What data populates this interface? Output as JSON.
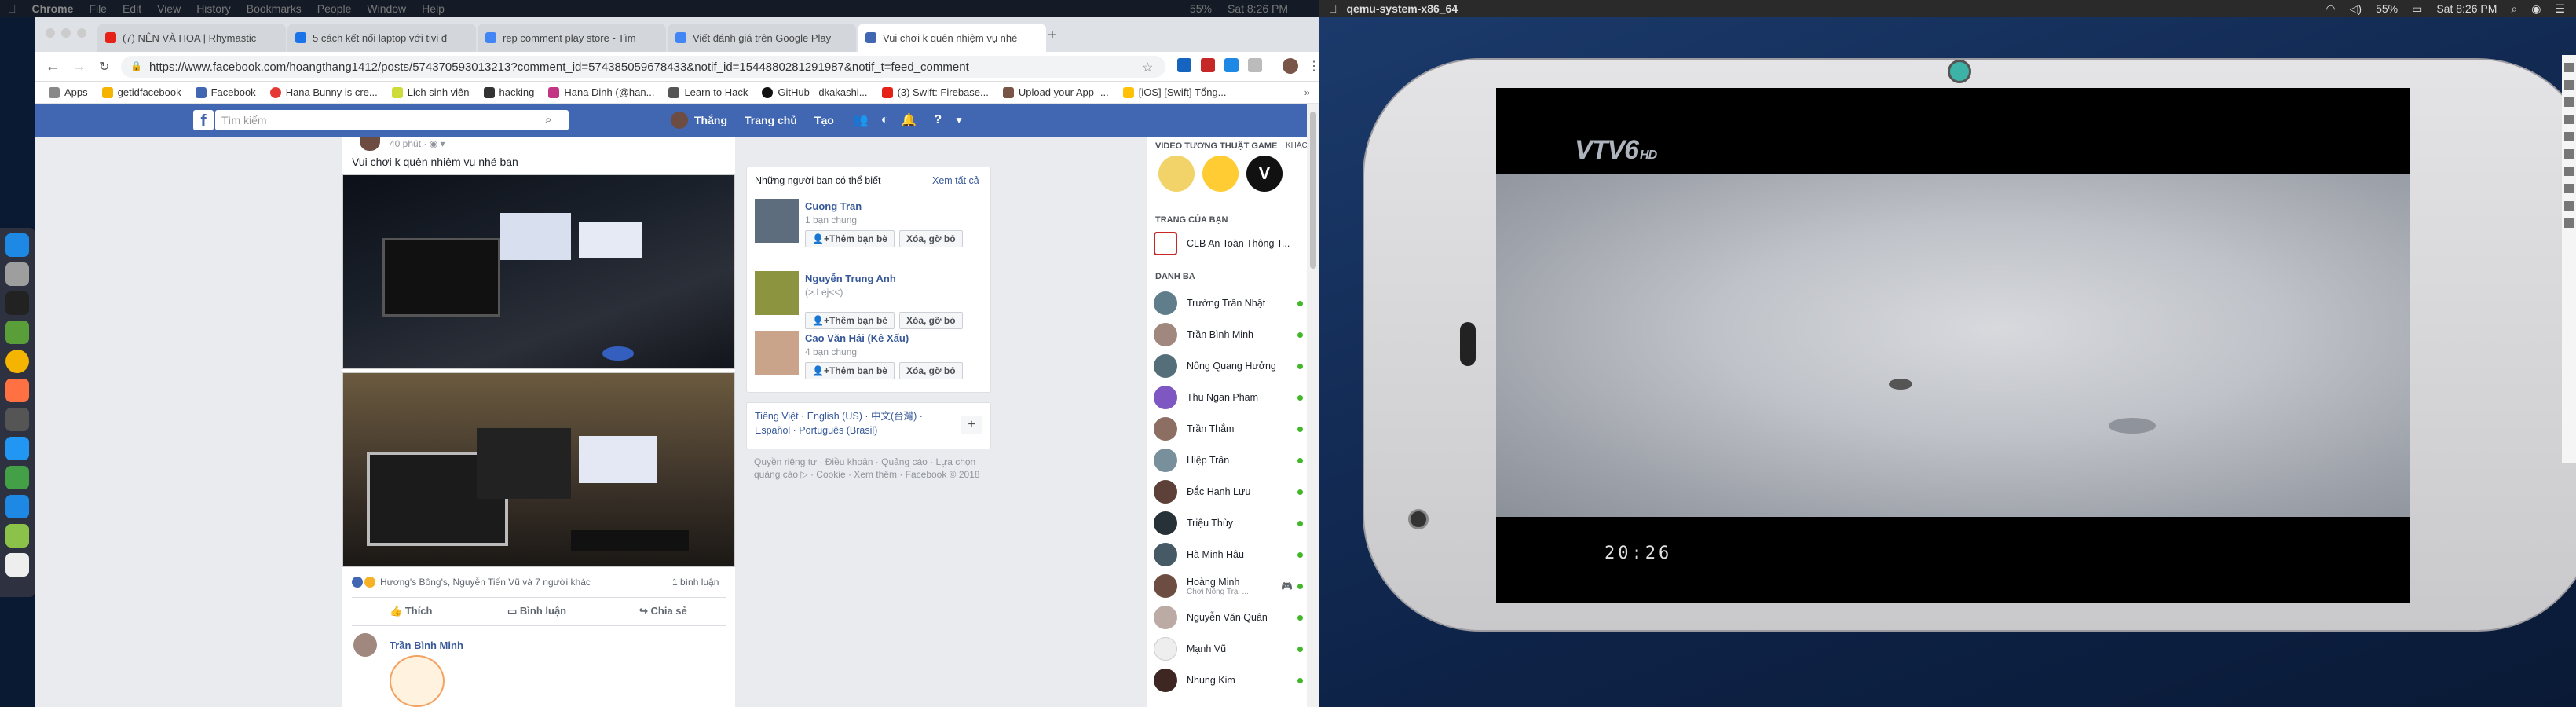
{
  "mac_menu_left": {
    "app": "Chrome",
    "items": [
      "File",
      "Edit",
      "View",
      "History",
      "Bookmarks",
      "People",
      "Window",
      "Help"
    ],
    "battery": "55%",
    "time": "Sat 8:26 PM"
  },
  "mac_menu_right": {
    "app": "qemu-system-x86_64",
    "battery": "55%",
    "time": "Sat 8:26 PM"
  },
  "tabs": [
    {
      "label": "(7) NÊN VÀ HOA | Rhymastic",
      "color": "#e62117"
    },
    {
      "label": "5 cách kết nối laptop với tivi đ",
      "color": "#1a73e8"
    },
    {
      "label": "rep comment play store - Tìm",
      "color": "#4285f4"
    },
    {
      "label": "Viết đánh giá trên Google Play",
      "color": "#4285f4"
    },
    {
      "label": "Vui chơi k quên nhiệm vụ nhé",
      "color": "#4267b2"
    }
  ],
  "url": "https://www.facebook.com/hoangthang1412/posts/574370593013213?comment_id=574385059678433&notif_id=1544880281291987&notif_t=feed_comment",
  "bookmarks": [
    "Apps",
    "getidfacebook",
    "Facebook",
    "Hana Bunny is cre...",
    "Lịch sinh viên",
    "hacking",
    "Hana Dinh (@han...",
    "Learn to Hack",
    "GitHub - dkakashi...",
    "(3) Swift: Firebase...",
    "Upload your App -...",
    "[iOS] [Swift] Tổng..."
  ],
  "fb": {
    "search_placeholder": "Tìm kiếm",
    "nav": {
      "user": "Thắng",
      "home": "Trang chủ",
      "create": "Tạo"
    },
    "post": {
      "time": "40 phút · ",
      "caption": "Vui chơi k quên nhiệm vụ nhé bạn",
      "reactions": "Hương's Bông's, Nguyễn Tiến Vũ và 7 người khác",
      "comments": "1 bình luận",
      "like": "Thích",
      "comment": "Bình luận",
      "share": "Chia sẻ",
      "commenter": "Trần Bình Minh"
    },
    "suggestions": {
      "title": "Những người bạn có thể biết",
      "see_all": "Xem tất cả",
      "add": "Thêm bạn bè",
      "remove": "Xóa, gỡ bỏ",
      "people": [
        {
          "name": "Cuong Tran",
          "sub": "1 bạn chung"
        },
        {
          "name": "Nguyễn Trung Anh",
          "sub": "(>.Lej<<)"
        },
        {
          "name": "Cao Văn Hải (Kê Xấu)",
          "sub": "4 bạn chung"
        }
      ]
    },
    "languages": "Tiếng Việt · English (US) · 中文(台灣) · Español · Português (Brasil)",
    "footer": "Quyền riêng tư · Điều khoản · Quảng cáo · Lựa chọn quảng cáo ▷ · Cookie · Xem thêm · Facebook © 2018",
    "chat": {
      "games_header": "VIDEO TƯƠNG THUẬT GAME",
      "games_more": "KHÁC",
      "pages_header": "TRANG CỦA BẠN",
      "page": "CLB An Toàn Thông T...",
      "contacts_header": "DANH BẠ",
      "contacts": [
        "Trường Trần Nhật",
        "Trần Bình Minh",
        "Nông Quang Hưởng",
        "Thu Ngan Pham",
        "Trần Thắm",
        "Hiệp Trần",
        "Đắc Hạnh Lưu",
        "Triệu Thùy",
        "Hà Minh Hậu",
        "Hoàng Minh",
        "Nguyễn Văn Quân",
        "Mạnh Vũ",
        "Nhung Kim"
      ],
      "hoang_sub": "Chơi Nông Trại ..."
    }
  },
  "tv": {
    "logo": "VTV6",
    "hd": "HD",
    "clock": "20:26"
  }
}
